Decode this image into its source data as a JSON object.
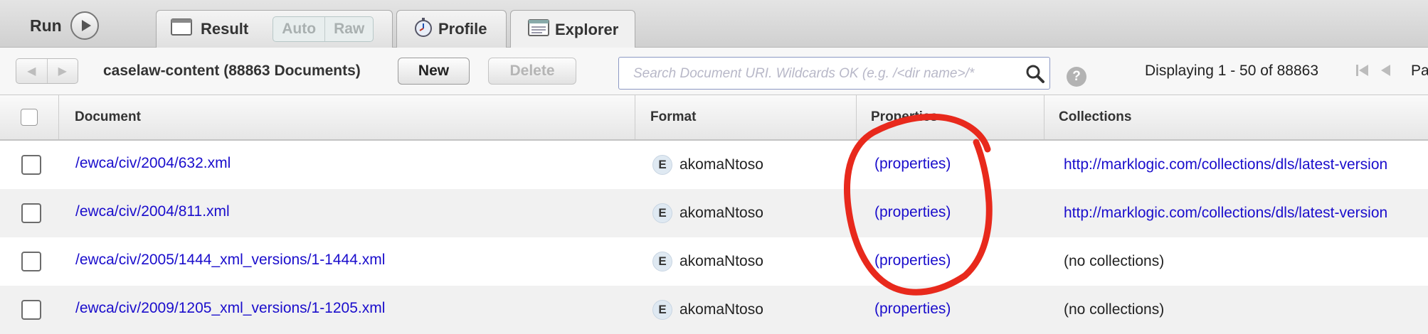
{
  "topbar": {
    "run_label": "Run",
    "tabs": [
      {
        "label": "Result",
        "options": [
          "Auto",
          "Raw"
        ]
      },
      {
        "label": "Profile"
      },
      {
        "label": "Explorer"
      }
    ]
  },
  "toolbar": {
    "database_label": "caselaw-content (88863 Documents)",
    "new_label": "New",
    "delete_label": "Delete",
    "search_placeholder": "Search Document URI. Wildcards OK (e.g. /<dir name>/*",
    "help_label": "?",
    "displaying_text": "Displaying 1 - 50 of 88863",
    "page_label": "Pa"
  },
  "table": {
    "columns": [
      "Document",
      "Format",
      "Properties",
      "Collections"
    ],
    "rows": [
      {
        "document": "/ewca/civ/2004/632.xml",
        "format_badge": "E",
        "format": "akomaNtoso",
        "properties": "(properties)",
        "collections": "http://marklogic.com/collections/dls/latest-version"
      },
      {
        "document": "/ewca/civ/2004/811.xml",
        "format_badge": "E",
        "format": "akomaNtoso",
        "properties": "(properties)",
        "collections": "http://marklogic.com/collections/dls/latest-version"
      },
      {
        "document": "/ewca/civ/2005/1444_xml_versions/1-1444.xml",
        "format_badge": "E",
        "format": "akomaNtoso",
        "properties": "(properties)",
        "collections": "(no collections)"
      },
      {
        "document": "/ewca/civ/2009/1205_xml_versions/1-1205.xml",
        "format_badge": "E",
        "format": "akomaNtoso",
        "properties": "(properties)",
        "collections": "(no collections)"
      }
    ]
  },
  "colors": {
    "link": "#1a0dcc",
    "annotation": "#e8291c"
  }
}
